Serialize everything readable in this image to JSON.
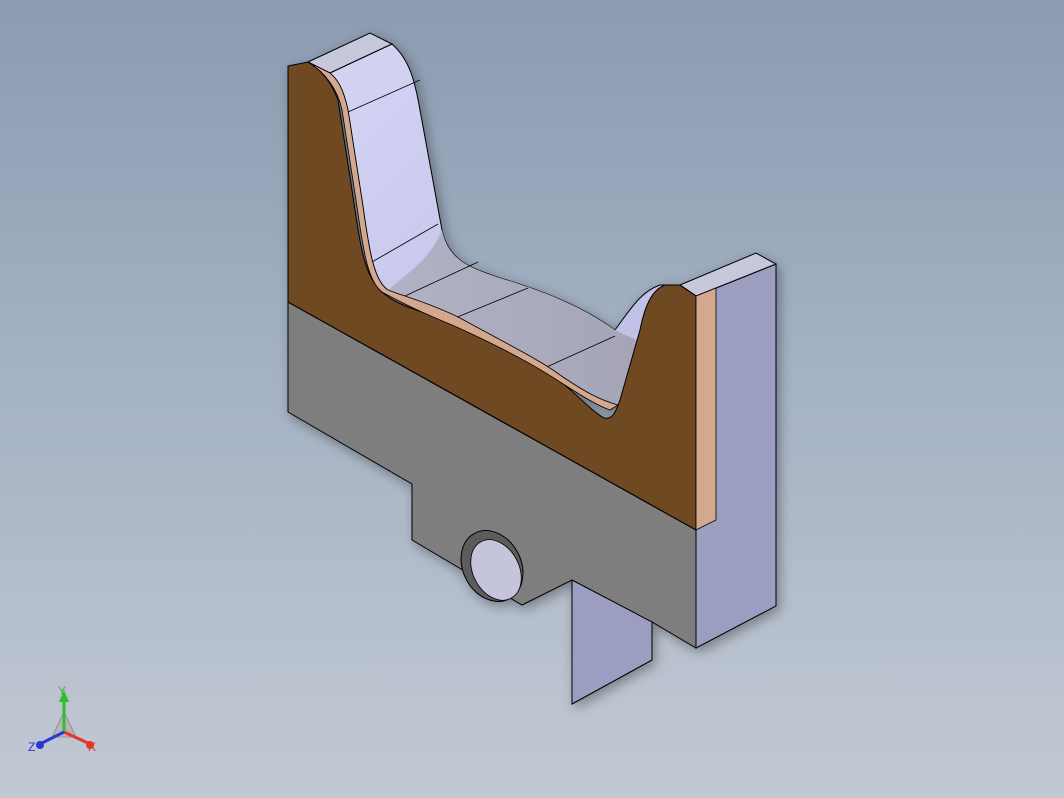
{
  "viewport": {
    "background_top": "#8b9bb0",
    "background_bottom": "#c2c9d3"
  },
  "part": {
    "colors": {
      "cut_section": "#6e4a23",
      "cut_edge_highlight": "#d4a78f",
      "side_face_gray": "#7e7e7e",
      "front_face_lavender": "#9b9ec0",
      "curved_surface": "#c9c9ee",
      "top_face": "#b8b8d0",
      "hole_inner": "#c4c4dc",
      "edge_line": "#000000"
    }
  },
  "triad": {
    "x_label": "X",
    "y_label": "Y",
    "z_label": "Z",
    "x_color": "#e8342a",
    "y_color": "#2fbd35",
    "z_color": "#2a38d8"
  }
}
